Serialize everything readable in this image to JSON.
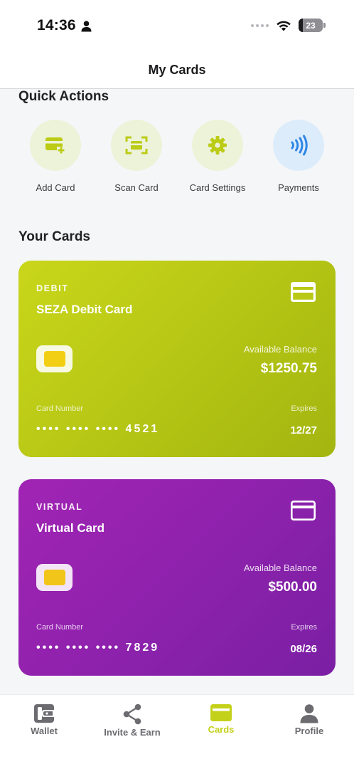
{
  "status_bar": {
    "time": "14:36",
    "battery": "23"
  },
  "header": {
    "title": "My Cards"
  },
  "quick_actions": {
    "title": "Quick Actions",
    "items": [
      {
        "label": "Add Card",
        "icon": "add-card-icon"
      },
      {
        "label": "Scan Card",
        "icon": "scan-card-icon"
      },
      {
        "label": "Card Settings",
        "icon": "gear-icon"
      },
      {
        "label": "Payments",
        "icon": "contactless-icon"
      }
    ]
  },
  "cards_section": {
    "title": "Your Cards"
  },
  "cards": [
    {
      "type": "DEBIT",
      "name": "SEZA Debit Card",
      "balance_label": "Available Balance",
      "balance": "$1250.75",
      "number_label": "Card Number",
      "number": "•••• •••• •••• 4521",
      "expires_label": "Expires",
      "expires": "12/27",
      "color": "#bccb16"
    },
    {
      "type": "VIRTUAL",
      "name": "Virtual Card",
      "balance_label": "Available Balance",
      "balance": "$500.00",
      "number_label": "Card Number",
      "number": "•••• •••• •••• 7829",
      "expires_label": "Expires",
      "expires": "08/26",
      "color": "#8e22ad"
    }
  ],
  "tab_bar": {
    "active": "Cards",
    "items": [
      {
        "label": "Wallet",
        "icon": "wallet-icon"
      },
      {
        "label": "Invite & Earn",
        "icon": "share-icon"
      },
      {
        "label": "Cards",
        "icon": "card-icon"
      },
      {
        "label": "Profile",
        "icon": "person-icon"
      }
    ]
  },
  "colors": {
    "accent": "#c4d11a",
    "payments_blue": "#2f86e6",
    "inactive_tab": "#6b6b70"
  }
}
